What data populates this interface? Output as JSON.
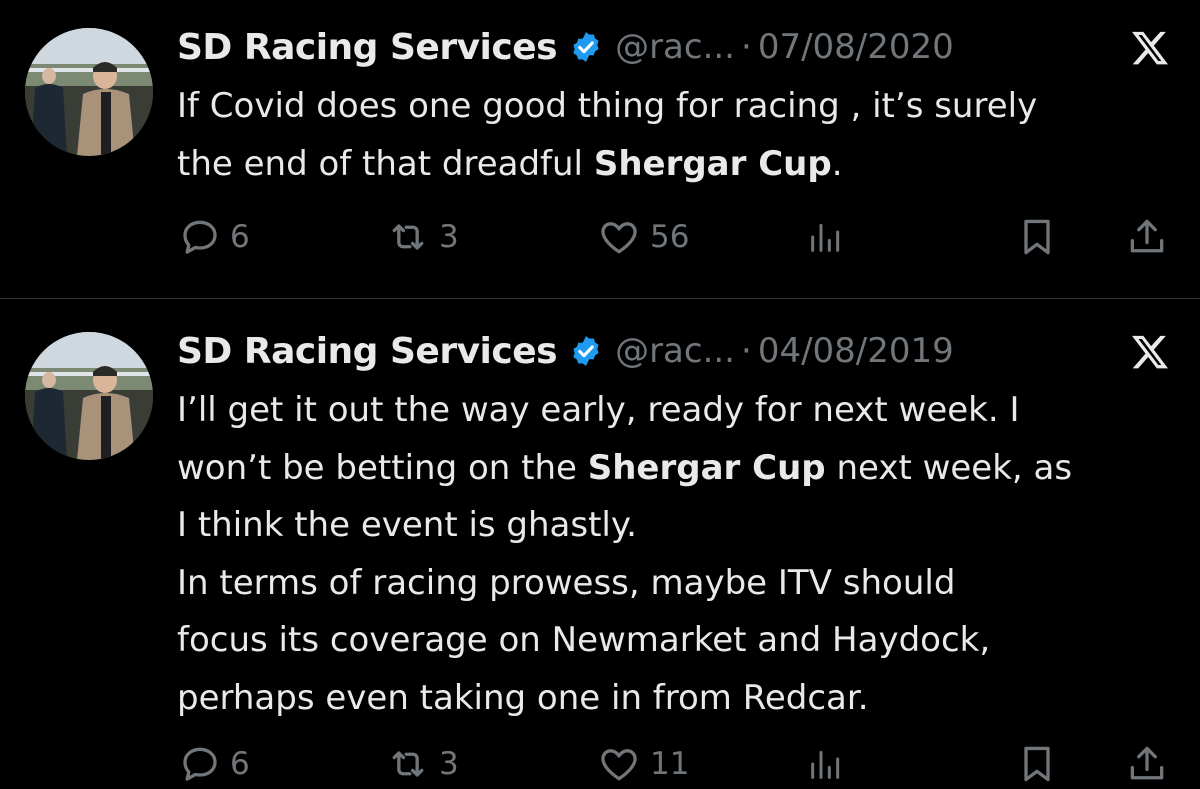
{
  "tweets": [
    {
      "name": "SD Racing Services",
      "handle": "@rac...",
      "separator": "·",
      "date": "07/08/2020",
      "body": {
        "l1": "If Covid does one good thing for racing , it’s surely",
        "l2a": "the end of that dreadful ",
        "l2b": "Shergar Cup",
        "l2c": "."
      },
      "replies": "6",
      "retweets": "3",
      "likes": "56"
    },
    {
      "name": "SD Racing Services",
      "handle": "@rac...",
      "separator": "·",
      "date": "04/08/2019",
      "body": {
        "l1": "I’ll get it out the way early, ready for next week. I",
        "l2a": "won’t be betting on the ",
        "l2b": "Shergar Cup",
        "l2c": " next week, as",
        "l3": "I think the event is ghastly.",
        "l4": "In terms of racing prowess, maybe ITV should",
        "l5": "focus its coverage on Newmarket and Haydock,",
        "l6": "perhaps even taking one in from Redcar."
      },
      "replies": "6",
      "retweets": "3",
      "likes": "11"
    }
  ],
  "colors": {
    "background": "#000000",
    "text": "#e7e9ea",
    "secondary": "#71767b",
    "verified": "#1d9bf0",
    "divider": "#2f3336"
  },
  "icons": [
    "avatar",
    "verified-badge-icon",
    "x-logo-icon",
    "reply-icon",
    "retweet-icon",
    "like-icon",
    "views-icon",
    "bookmark-icon",
    "share-icon"
  ]
}
